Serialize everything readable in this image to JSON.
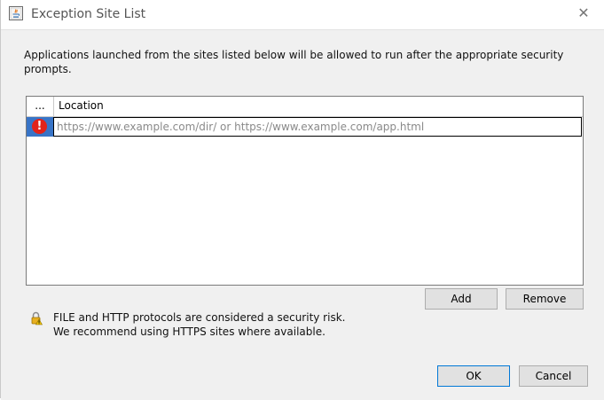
{
  "window": {
    "title": "Exception Site List",
    "close_glyph": "✕"
  },
  "description": "Applications launched from the sites listed below will be allowed to run after the appropriate security prompts.",
  "table": {
    "columns": [
      "...",
      "Location"
    ],
    "rows": [
      {
        "status_icon": "error-icon",
        "status_glyph": "!",
        "value": "",
        "placeholder": "https://www.example.com/dir/ or https://www.example.com/app.html"
      }
    ]
  },
  "buttons": {
    "add": "Add",
    "remove": "Remove",
    "ok": "OK",
    "cancel": "Cancel"
  },
  "warning": {
    "icon": "padlock-warning-icon",
    "line1": "FILE and HTTP protocols are considered a security risk.",
    "line2": "We recommend using HTTPS sites where available."
  },
  "colors": {
    "selection": "#3874c7",
    "error": "#e2231a",
    "default_button_border": "#0078d7"
  }
}
